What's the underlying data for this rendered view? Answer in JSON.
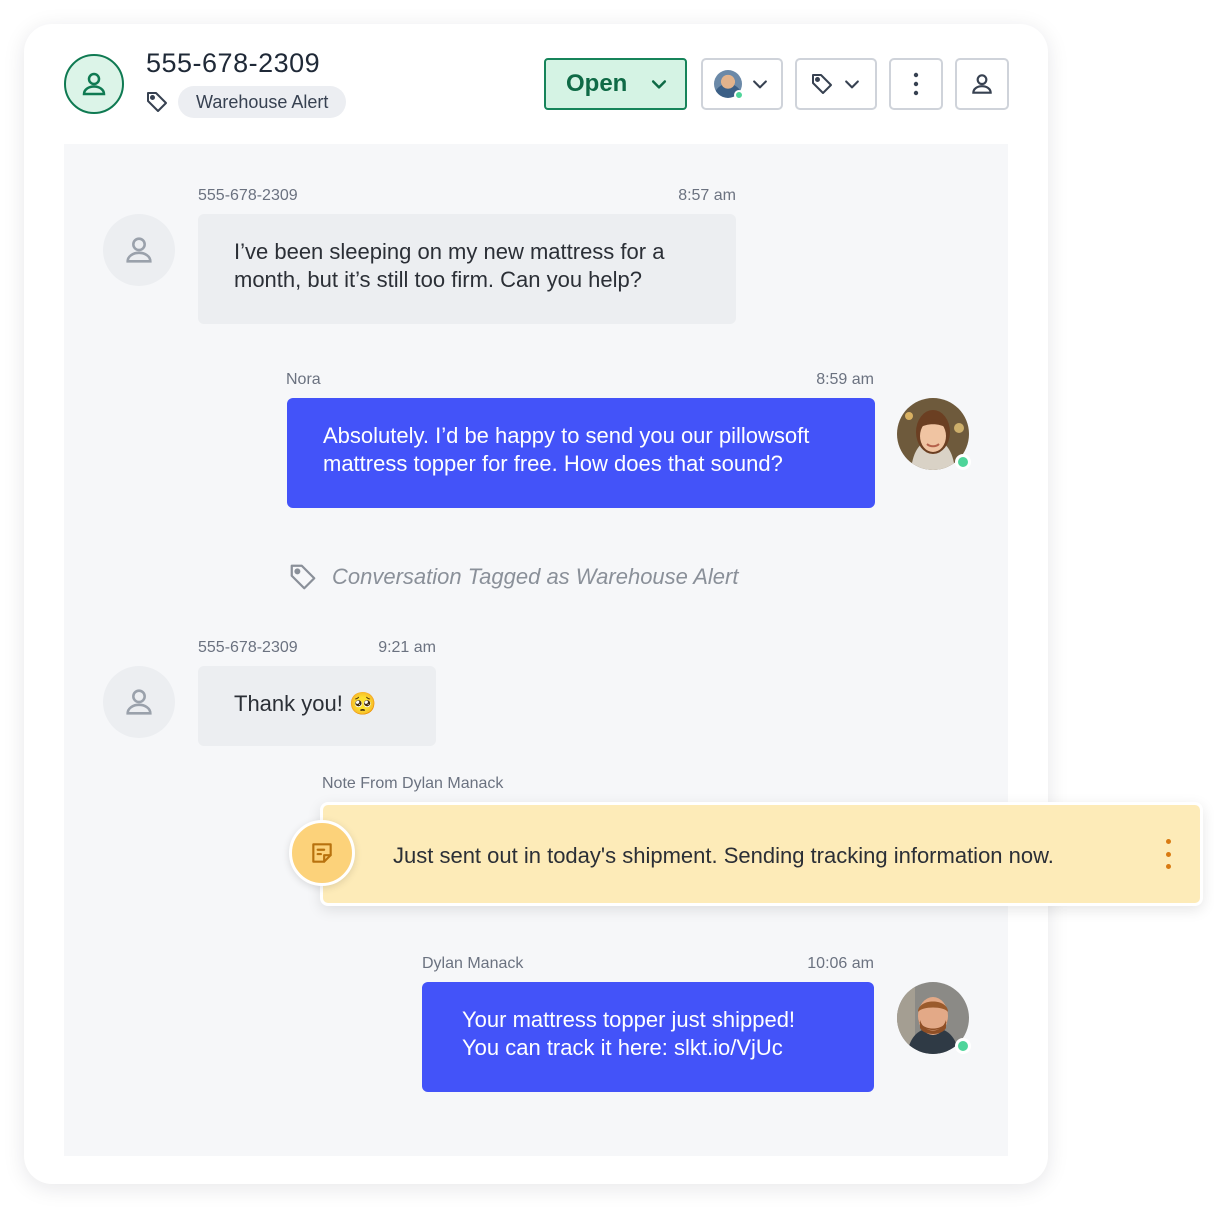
{
  "header": {
    "contact_name": "555-678-2309",
    "tag_label": "Warehouse Alert",
    "status_label": "Open",
    "icons": {
      "contact": "user-icon",
      "tag": "tag-icon",
      "status_dropdown": "chevron-down-icon",
      "assignee_dropdown": "chevron-down-icon",
      "tag_menu": "tag-icon",
      "more": "more-vertical-icon",
      "profile": "user-icon"
    }
  },
  "messages": [
    {
      "sender": "555-678-2309",
      "time": "8:57 am",
      "text_lines": [
        "I’ve been sleeping on my new mattress for a",
        "month, but it’s still too firm. Can you help?"
      ],
      "direction": "inbound"
    },
    {
      "sender": "Nora",
      "time": "8:59 am",
      "text_lines": [
        "Absolutely. I’d be happy to send you our pillowsoft",
        "mattress topper for free. How does that sound?"
      ],
      "direction": "outbound"
    },
    {
      "sender": "555-678-2309",
      "time": "9:21 am",
      "text": "Thank you! 🥺",
      "direction": "inbound"
    },
    {
      "sender": "Dylan Manack",
      "time": "10:06 am",
      "text_lines": [
        "Your mattress topper just shipped!",
        "You can track it here: slkt.io/VjUc"
      ],
      "direction": "outbound"
    }
  ],
  "event": {
    "text": "Conversation Tagged as Warehouse Alert"
  },
  "note": {
    "label": "Note From Dylan Manack",
    "text": "Just sent out in today's shipment. Sending tracking information now."
  },
  "colors": {
    "open_green": "#16845a",
    "outbound_blue": "#4353f9",
    "note_yellow": "#fdebb8",
    "online_dot": "#4fd59a"
  }
}
